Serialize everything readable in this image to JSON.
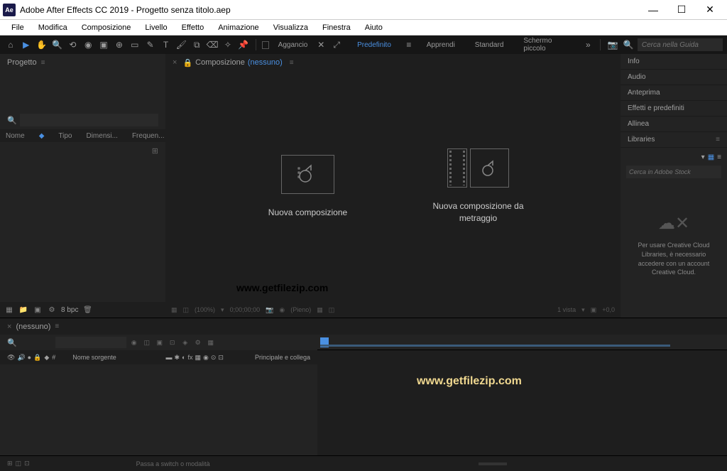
{
  "titlebar": {
    "icon": "Ae",
    "text": "Adobe After Effects CC 2019 - Progetto senza titolo.aep"
  },
  "menu": [
    "File",
    "Modifica",
    "Composizione",
    "Livello",
    "Effetto",
    "Animazione",
    "Visualizza",
    "Finestra",
    "Aiuto"
  ],
  "toolbar": {
    "snap_label": "Aggancio",
    "workspaces": [
      "Predefinito",
      "Apprendi",
      "Standard",
      "Schermo piccolo"
    ],
    "search_placeholder": "Cerca nella Guida"
  },
  "project": {
    "title": "Progetto",
    "columns": {
      "nome": "Nome",
      "tipo": "Tipo",
      "dimens": "Dimensi...",
      "frequen": "Frequen..."
    },
    "footer_bpc": "8 bpc"
  },
  "comp": {
    "tab_label": "Composizione",
    "tab_none": "(nessuno)",
    "new_comp": "Nuova composizione",
    "new_from_footage": "Nuova composizione da metraggio",
    "footer_zoom": "(100%)",
    "footer_time": "0;00;00;00",
    "footer_pieno": "(Pieno)",
    "footer_vista": "1 vista",
    "footer_rot": "+0,0"
  },
  "right_panels": [
    "Info",
    "Audio",
    "Anteprima",
    "Effetti e predefiniti",
    "Allinea",
    "Libraries"
  ],
  "libraries": {
    "search_placeholder": "Cerca in Adobe Stock",
    "empty_text": "Per usare Creative Cloud Libraries, è necessario accedere con un account Creative Cloud."
  },
  "timeline": {
    "tab_none": "(nessuno)",
    "col_num": "#",
    "col_name": "Nome sorgente",
    "col_parent": "Principale e collega"
  },
  "status": {
    "hint": "Passa a switch o modalità"
  },
  "watermark": "www.getfilezip.com"
}
